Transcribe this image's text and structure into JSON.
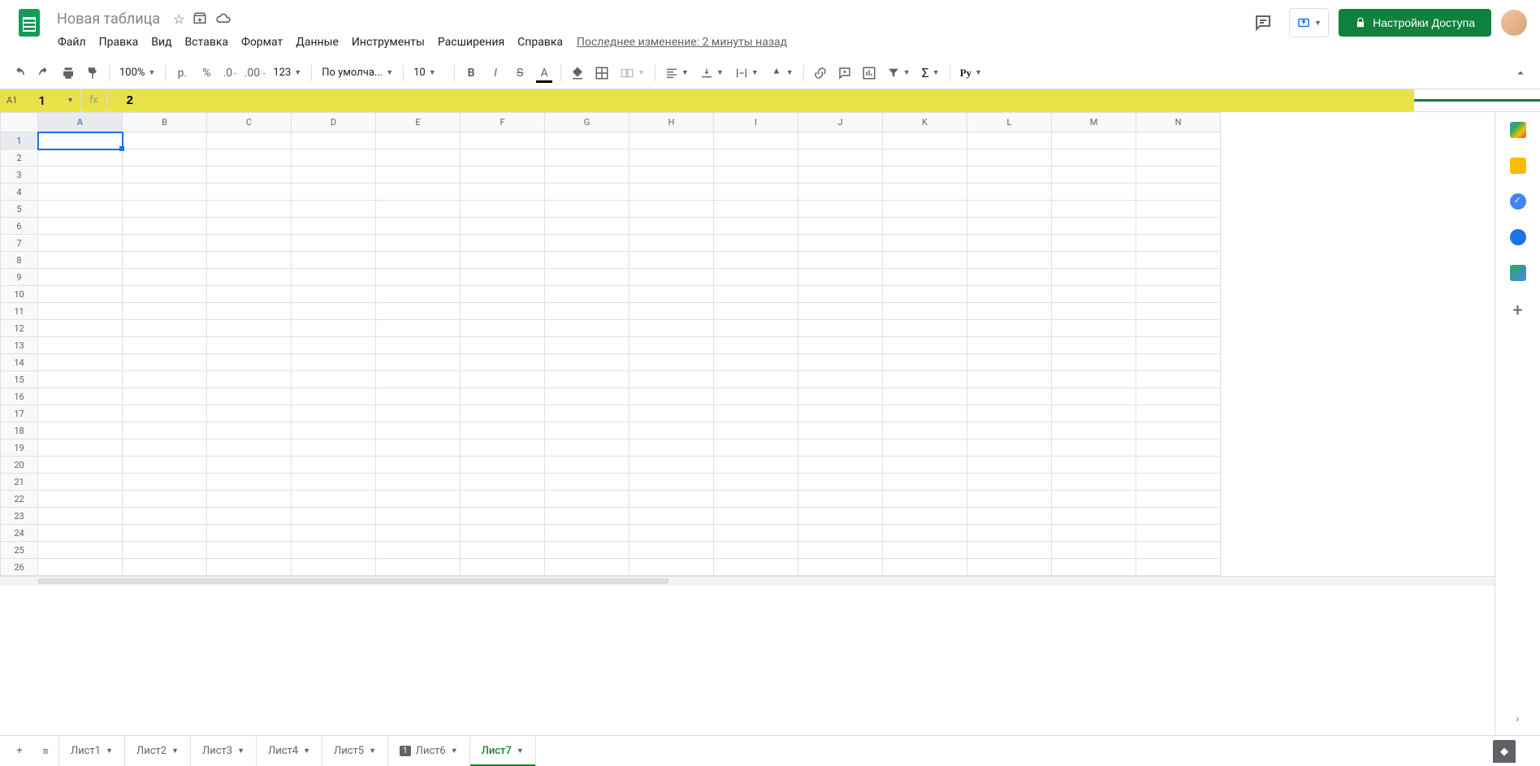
{
  "document": {
    "title": "Новая таблица",
    "last_edit": "Последнее изменение: 2 минуты назад"
  },
  "menubar": [
    "Файл",
    "Правка",
    "Вид",
    "Вставка",
    "Формат",
    "Данные",
    "Инструменты",
    "Расширения",
    "Справка"
  ],
  "toolbar": {
    "zoom": "100%",
    "currency": "р.",
    "percent": "%",
    "dec_less": ".0",
    "dec_more": ".00",
    "num_format": "123",
    "font": "По умолча...",
    "font_size": "10"
  },
  "share_label": "Настройки Доступа",
  "name_box": {
    "ref": "A1",
    "badge": "1"
  },
  "formula": {
    "badge": "2"
  },
  "columns": [
    "A",
    "B",
    "C",
    "D",
    "E",
    "F",
    "G",
    "H",
    "I",
    "J",
    "K",
    "L",
    "M",
    "N"
  ],
  "rows": [
    1,
    2,
    3,
    4,
    5,
    6,
    7,
    8,
    9,
    10,
    11,
    12,
    13,
    14,
    15,
    16,
    17,
    18,
    19,
    20,
    21,
    22,
    23,
    24,
    25,
    26
  ],
  "selected_cell": "A1",
  "tabs": [
    {
      "label": "Лист1"
    },
    {
      "label": "Лист2"
    },
    {
      "label": "Лист3"
    },
    {
      "label": "Лист4"
    },
    {
      "label": "Лист5"
    },
    {
      "label": "Лист6",
      "badge": "1"
    },
    {
      "label": "Лист7",
      "active": true
    }
  ]
}
